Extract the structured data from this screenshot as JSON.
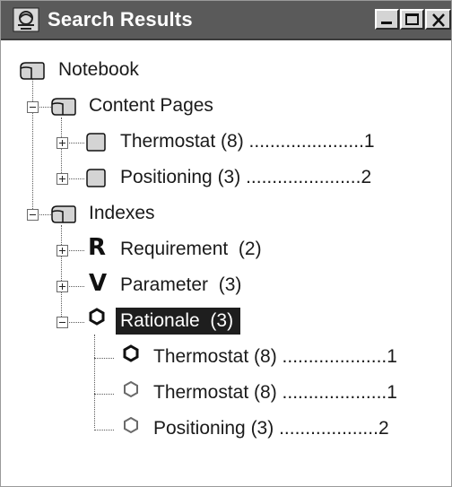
{
  "window": {
    "title": "Search Results"
  },
  "tree": {
    "root": "Notebook",
    "content_pages": {
      "label": "Content Pages",
      "items": [
        {
          "label": "Thermostat (8) ",
          "dots": "......................",
          "page": "1"
        },
        {
          "label": "Positioning (3) ",
          "dots": "......................",
          "page": "2"
        }
      ]
    },
    "indexes": {
      "label": "Indexes",
      "items": [
        {
          "label": "Requirement  (2)"
        },
        {
          "label": "Parameter  (3)"
        },
        {
          "label": "Rationale  (3)",
          "selected": true,
          "children": [
            {
              "label": "Thermostat (8) ",
              "dots": "....................",
              "page": "1"
            },
            {
              "label": "Thermostat (8) ",
              "dots": "....................",
              "page": "1"
            },
            {
              "label": "Positioning (3) ",
              "dots": "...................",
              "page": "2"
            }
          ]
        }
      ]
    }
  },
  "icons": {
    "requirement": "R",
    "parameter": "V"
  }
}
